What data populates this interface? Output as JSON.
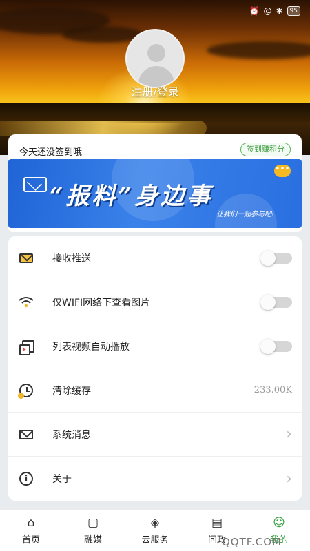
{
  "statusbar": {
    "time": "",
    "battery": "95",
    "icons": [
      "signal-icon",
      "wifi-icon",
      "alarm-icon",
      "bluetooth-icon"
    ]
  },
  "profile": {
    "login_label": "注册/登录"
  },
  "sign_in": {
    "status_text": "今天还没签到哦",
    "button_label": "签到赚积分"
  },
  "banner": {
    "title": "“报料”身边事",
    "subtitle": "让我们一起参与吧!"
  },
  "settings": {
    "items": [
      {
        "icon": "mail-icon",
        "label": "接收推送",
        "type": "toggle",
        "on": false
      },
      {
        "icon": "wifi-icon",
        "label": "仅WIFI网络下查看图片",
        "type": "toggle",
        "on": false
      },
      {
        "icon": "video-icon",
        "label": "列表视频自动播放",
        "type": "toggle",
        "on": false
      },
      {
        "icon": "clock-icon",
        "label": "清除缓存",
        "type": "value",
        "value": "233.00K"
      },
      {
        "icon": "message-icon",
        "label": "系统消息",
        "type": "link"
      },
      {
        "icon": "info-icon",
        "label": "关于",
        "type": "link"
      }
    ]
  },
  "tabbar": {
    "tabs": [
      {
        "label": "首页",
        "icon": "home-icon",
        "active": false
      },
      {
        "label": "融媒",
        "icon": "tv-icon",
        "active": false
      },
      {
        "label": "云服务",
        "icon": "layers-icon",
        "active": false
      },
      {
        "label": "问政",
        "icon": "document-icon",
        "active": false
      },
      {
        "label": "我的",
        "icon": "person-icon",
        "active": true
      }
    ]
  },
  "watermark": "QQTF.COM",
  "colors": {
    "accent_green": "#2e9d38",
    "banner_blue": "#2a6fe0",
    "page_bg": "#e9ecef"
  }
}
